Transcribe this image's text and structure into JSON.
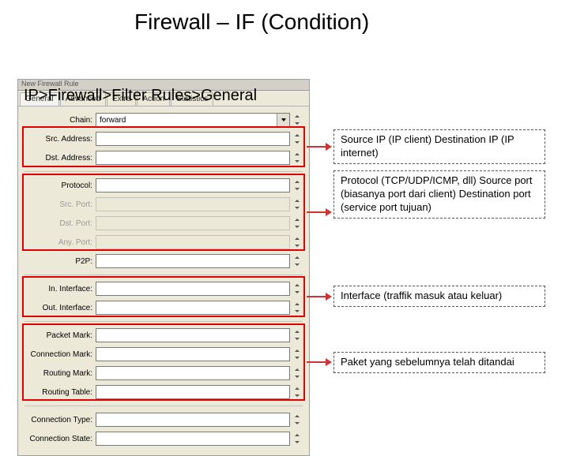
{
  "title": "Firewall – IF (Condition)",
  "breadcrumb": "IP>Firewall>Filter Rules>General",
  "dialog": {
    "header": "New Firewall Rule",
    "tabs": [
      "General",
      "Advanced",
      "Extra",
      "Action",
      "Statistics"
    ],
    "labels": {
      "chain": "Chain:",
      "srcAddr": "Src. Address:",
      "dstAddr": "Dst. Address:",
      "protocol": "Protocol:",
      "srcPort": "Src. Port:",
      "dstPort": "Dst. Port:",
      "anyPort": "Any. Port:",
      "p2p": "P2P:",
      "inIf": "In. Interface:",
      "outIf": "Out. Interface:",
      "pktMark": "Packet Mark:",
      "connMark": "Connection Mark:",
      "routeMark": "Routing Mark:",
      "routeTable": "Routing Table:",
      "connType": "Connection Type:",
      "connState": "Connection State:"
    },
    "values": {
      "chain": "forward"
    }
  },
  "annotations": {
    "a1": "Source IP (IP client) Destination IP (IP internet)",
    "a2": "Protocol (TCP/UDP/ICMP, dll) Source port (biasanya port dari client) Destination port (service port  tujuan)",
    "a3": "Interface (traffik masuk atau keluar)",
    "a4": "Paket yang sebelumnya telah ditandai"
  }
}
